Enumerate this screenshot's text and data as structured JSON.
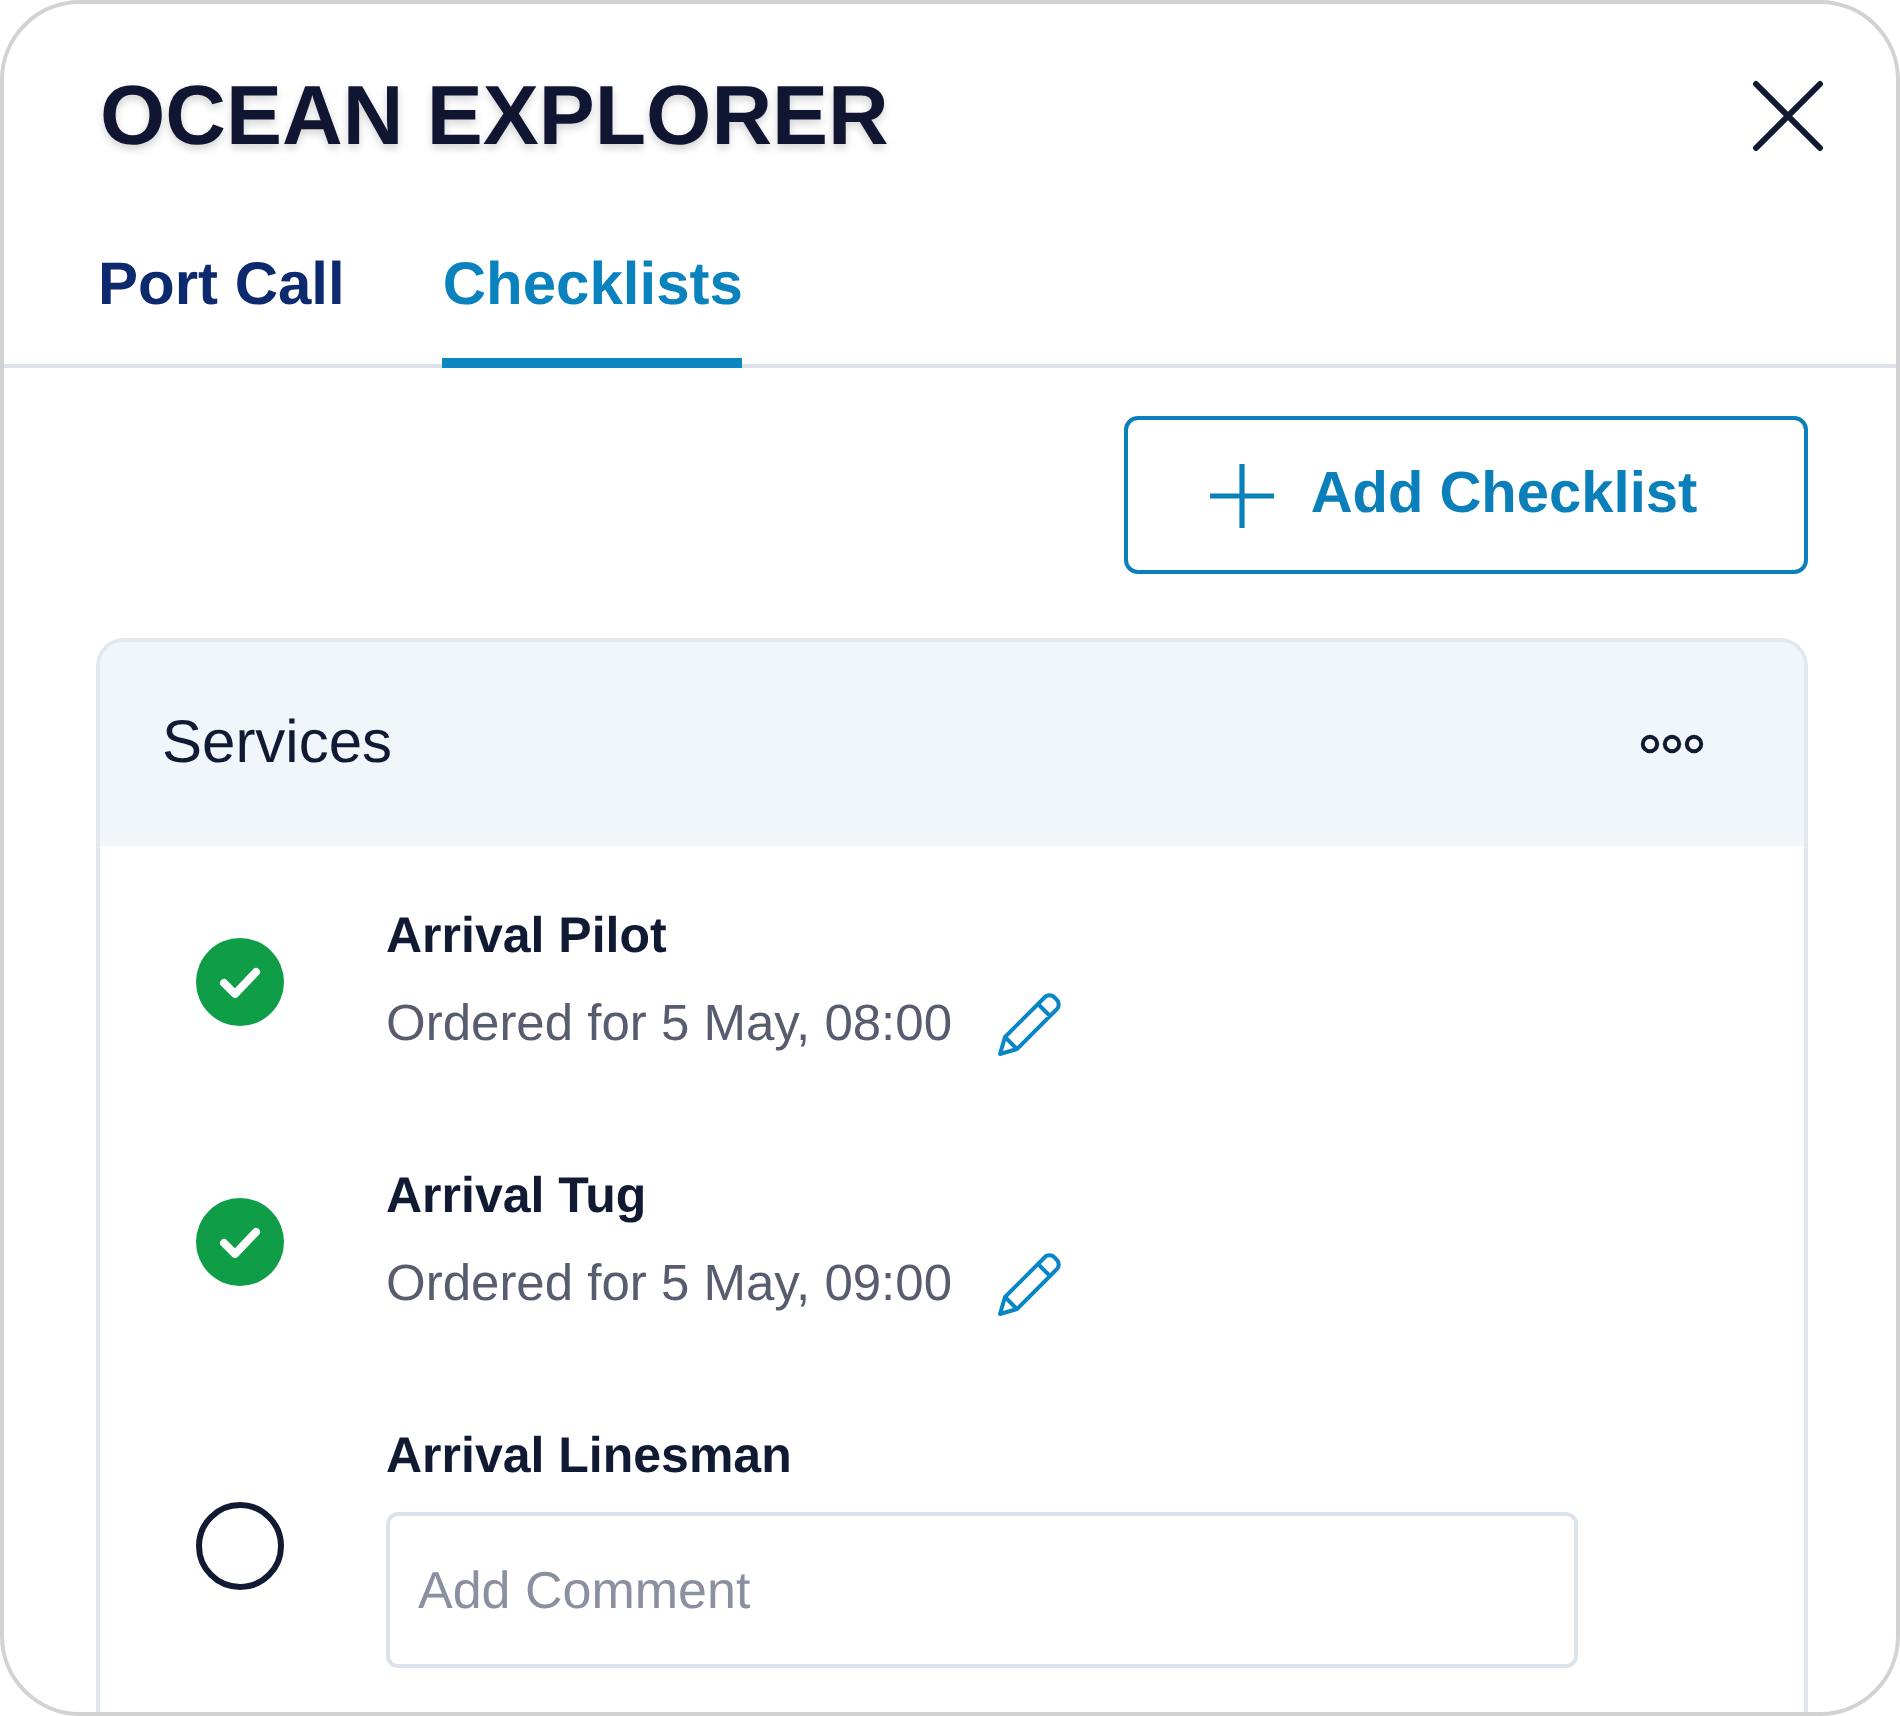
{
  "window": {
    "title": "OCEAN EXPLORER"
  },
  "tabs": [
    {
      "label": "Port Call",
      "selected": false
    },
    {
      "label": "Checklists",
      "selected": true
    }
  ],
  "add_button": {
    "label": "Add Checklist"
  },
  "checklist": {
    "title": "Services",
    "items": [
      {
        "kind": "ordered",
        "name": "Arrival Pilot",
        "checked": true,
        "note": "Ordered for 5 May, 08:00"
      },
      {
        "kind": "ordered",
        "name": "Arrival Tug",
        "checked": true,
        "note": "Ordered for 5 May, 09:00"
      },
      {
        "kind": "comment",
        "name": "Arrival Linesman",
        "checked": false,
        "comment": {
          "placeholder": "Add Comment"
        }
      }
    ]
  }
}
